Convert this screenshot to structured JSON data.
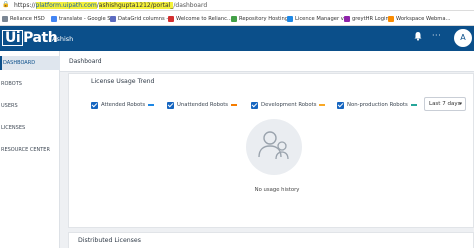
{
  "browser": {
    "url_prefix": "https://",
    "url_host": "platform.uipath.com",
    "url_mid": "/",
    "url_account": "ashishgupta1212/portal_",
    "url_rest": "/dashboard",
    "bookmarks": [
      {
        "label": "Reliance HSD",
        "icon": "page-icon",
        "color": "#7b8794"
      },
      {
        "label": "translate - Google S...",
        "icon": "google-icon",
        "color": "#4285f4"
      },
      {
        "label": "DataGrid columns -...",
        "icon": "page-icon",
        "color": "#5c6bc0"
      },
      {
        "label": "Welcome to Relianc...",
        "icon": "page-icon",
        "color": "#d32f2f"
      },
      {
        "label": "Repository Hosting",
        "icon": "page-icon",
        "color": "#43a047"
      },
      {
        "label": "Licence Manager v...",
        "icon": "page-icon",
        "color": "#1e88e5"
      },
      {
        "label": "greytHR Login",
        "icon": "page-icon",
        "color": "#8e24aa"
      },
      {
        "label": "Workspace Webma...",
        "icon": "page-icon",
        "color": "#fb8c00"
      }
    ]
  },
  "header": {
    "logo_box": "Ui",
    "logo_text": "Path",
    "tenant": "Ashish",
    "bell_icon": "bell-icon",
    "more_icon": "more-icon",
    "more_glyph": "···",
    "avatar_initial": "A"
  },
  "sidebar": {
    "items": [
      {
        "label": "DASHBOARD",
        "active": true
      },
      {
        "label": "ROBOTS"
      },
      {
        "label": "USERS"
      },
      {
        "label": "LICENSES"
      },
      {
        "label": "RESOURCE CENTER"
      }
    ]
  },
  "page": {
    "title": "Dashboard"
  },
  "license_card": {
    "title": "License Usage Trend",
    "legend": [
      {
        "label": "Attended Robots",
        "color": "#1e88e5"
      },
      {
        "label": "Unattended Robots",
        "color": "#f57c00"
      },
      {
        "label": "Development Robots",
        "color": "#f9a825"
      },
      {
        "label": "Non-production Robots",
        "color": "#26a69a"
      }
    ],
    "range_select": "Last 7 days",
    "empty_text": "No usage history"
  },
  "distributed_card": {
    "title": "Distributed Licenses"
  }
}
